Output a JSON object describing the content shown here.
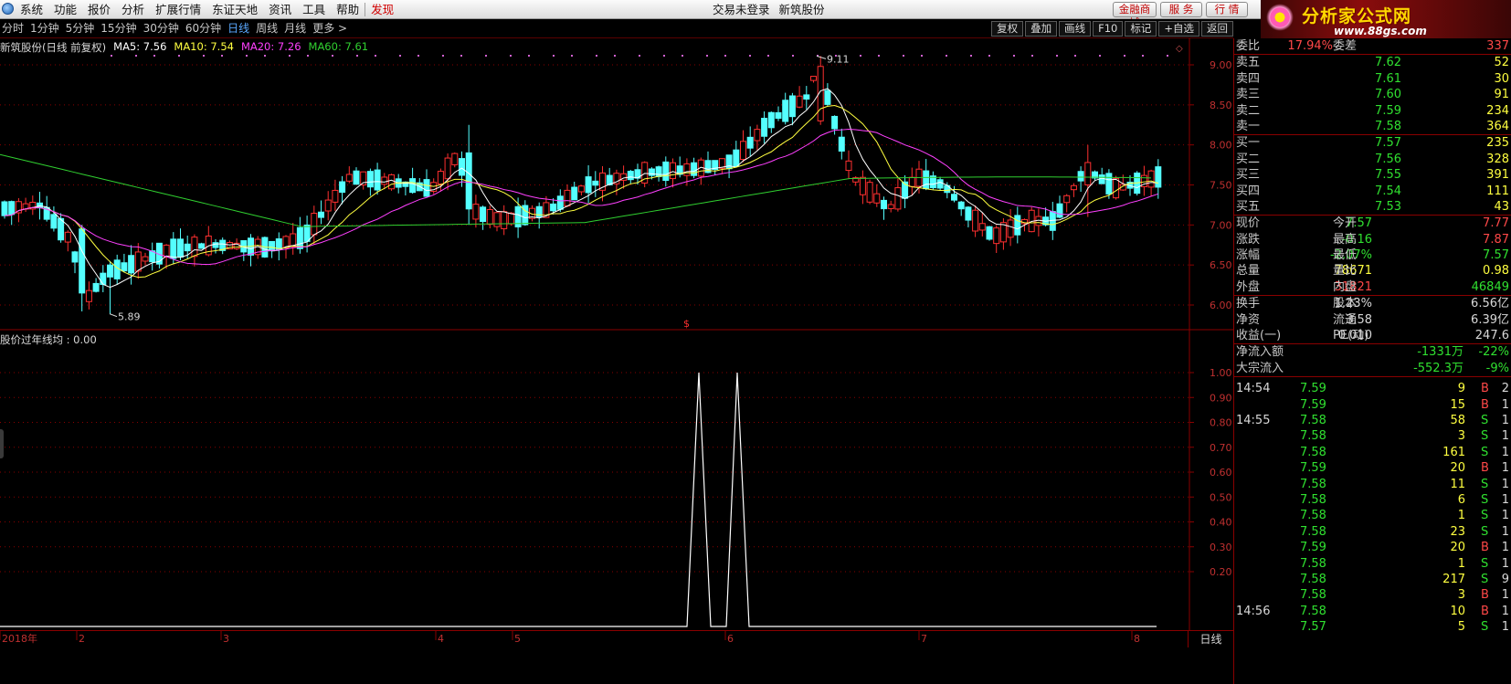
{
  "menubar": {
    "items": [
      "系统",
      "功能",
      "报价",
      "分析",
      "扩展行情",
      "东证天地",
      "资讯",
      "工具",
      "帮助",
      "发现"
    ],
    "center": [
      "交易未登录",
      "新筑股份"
    ],
    "buttons": [
      "金融商城",
      "服 务",
      "行 情"
    ]
  },
  "brand": {
    "name": "分析家公式网",
    "url": "www.88gs.com"
  },
  "periodbar": {
    "items": [
      "分时",
      "1分钟",
      "5分钟",
      "15分钟",
      "30分钟",
      "60分钟",
      "日线",
      "周线",
      "月线",
      "更多 >"
    ],
    "active_index": 6,
    "right_buttons": [
      "复权",
      "叠加",
      "画线",
      "F10",
      "标记",
      "+自选",
      "返回"
    ]
  },
  "legend": {
    "title": "新筑股份(日线 前复权)",
    "ma5": "MA5: 7.56",
    "ma10": "MA10: 7.54",
    "ma20": "MA20: 7.26",
    "ma60": "MA60: 7.61"
  },
  "kline_labels": {
    "high": "9.11",
    "low": "5.89"
  },
  "yaxis": [
    "9.00",
    "8.50",
    "8.00",
    "7.50",
    "7.00",
    "6.50",
    "6.00"
  ],
  "indicator": {
    "legend": "股价过年线均 : 0.00",
    "yaxis": [
      "1.00",
      "0.90",
      "0.80",
      "0.70",
      "0.60",
      "0.50",
      "0.40",
      "0.30",
      "0.20"
    ]
  },
  "xaxis": {
    "labels": [
      "2018年",
      "2",
      "3",
      "4",
      "5",
      "6",
      "7",
      "8"
    ],
    "period_label": "日线"
  },
  "colors": {
    "up": "#ff3030",
    "down": "#54ffff",
    "ma5": "#ffffff",
    "ma10": "#ffff40",
    "ma20": "#ff40ff",
    "ma60": "#30d030",
    "border": "#8a0000",
    "grid": "#8a0000"
  },
  "quote": {
    "weibi": {
      "label": "委比",
      "value": "17.94%",
      "label2": "委差",
      "value2": "337"
    },
    "asks": [
      {
        "label": "卖五",
        "price": "7.62",
        "vol": "52"
      },
      {
        "label": "卖四",
        "price": "7.61",
        "vol": "30"
      },
      {
        "label": "卖三",
        "price": "7.60",
        "vol": "91"
      },
      {
        "label": "卖二",
        "price": "7.59",
        "vol": "234"
      },
      {
        "label": "卖一",
        "price": "7.58",
        "vol": "364"
      }
    ],
    "bids": [
      {
        "label": "买一",
        "price": "7.57",
        "vol": "235"
      },
      {
        "label": "买二",
        "price": "7.56",
        "vol": "328"
      },
      {
        "label": "买三",
        "price": "7.55",
        "vol": "391"
      },
      {
        "label": "买四",
        "price": "7.54",
        "vol": "111"
      },
      {
        "label": "买五",
        "price": "7.53",
        "vol": "43"
      }
    ],
    "stats1": [
      {
        "l1": "现价",
        "v1": "7.57",
        "c1": "g",
        "l2": "今开",
        "v2": "7.77",
        "c2": "r"
      },
      {
        "l1": "涨跌",
        "v1": "-0.16",
        "c1": "g",
        "l2": "最高",
        "v2": "7.87",
        "c2": "r"
      },
      {
        "l1": "涨幅",
        "v1": "-2.07%",
        "c1": "g",
        "l2": "最低",
        "v2": "7.57",
        "c2": "g"
      },
      {
        "l1": "总量",
        "v1": "78671",
        "c1": "y",
        "l2": "量比",
        "v2": "0.98",
        "c2": "y"
      },
      {
        "l1": "外盘",
        "v1": "31821",
        "c1": "r",
        "l2": "内盘",
        "v2": "46849",
        "c2": "g"
      }
    ],
    "stats2": [
      {
        "l1": "换手",
        "v1": "1.23%",
        "l2": "股本",
        "v2": "6.56亿"
      },
      {
        "l1": "净资",
        "v1": "3.58",
        "l2": "流通",
        "v2": "6.39亿"
      },
      {
        "l1": "收益(一)",
        "v1": "0.010",
        "l2": "PE(动)",
        "v2": "247.6"
      }
    ],
    "flows": [
      {
        "label": "净流入额",
        "value": "-1331万",
        "pct": "-22%"
      },
      {
        "label": "大宗流入",
        "value": "-552.3万",
        "pct": "-9%"
      }
    ]
  },
  "ticks": [
    {
      "t": "14:54",
      "p": "7.59",
      "v": "9",
      "bs": "B",
      "n": "2"
    },
    {
      "t": "",
      "p": "7.59",
      "v": "15",
      "bs": "B",
      "n": "1"
    },
    {
      "t": "14:55",
      "p": "7.58",
      "v": "58",
      "bs": "S",
      "n": "1"
    },
    {
      "t": "",
      "p": "7.58",
      "v": "3",
      "bs": "S",
      "n": "1"
    },
    {
      "t": "",
      "p": "7.58",
      "v": "161",
      "bs": "S",
      "n": "1"
    },
    {
      "t": "",
      "p": "7.59",
      "v": "20",
      "bs": "B",
      "n": "1"
    },
    {
      "t": "",
      "p": "7.58",
      "v": "11",
      "bs": "S",
      "n": "1"
    },
    {
      "t": "",
      "p": "7.58",
      "v": "6",
      "bs": "S",
      "n": "1"
    },
    {
      "t": "",
      "p": "7.58",
      "v": "1",
      "bs": "S",
      "n": "1"
    },
    {
      "t": "",
      "p": "7.58",
      "v": "23",
      "bs": "S",
      "n": "1"
    },
    {
      "t": "",
      "p": "7.59",
      "v": "20",
      "bs": "B",
      "n": "1"
    },
    {
      "t": "",
      "p": "7.58",
      "v": "1",
      "bs": "S",
      "n": "1"
    },
    {
      "t": "",
      "p": "7.58",
      "v": "217",
      "bs": "S",
      "n": "9"
    },
    {
      "t": "",
      "p": "7.58",
      "v": "3",
      "bs": "B",
      "n": "1"
    },
    {
      "t": "14:56",
      "p": "7.58",
      "v": "10",
      "bs": "B",
      "n": "1"
    },
    {
      "t": "",
      "p": "7.57",
      "v": "5",
      "bs": "S",
      "n": "1"
    }
  ]
}
